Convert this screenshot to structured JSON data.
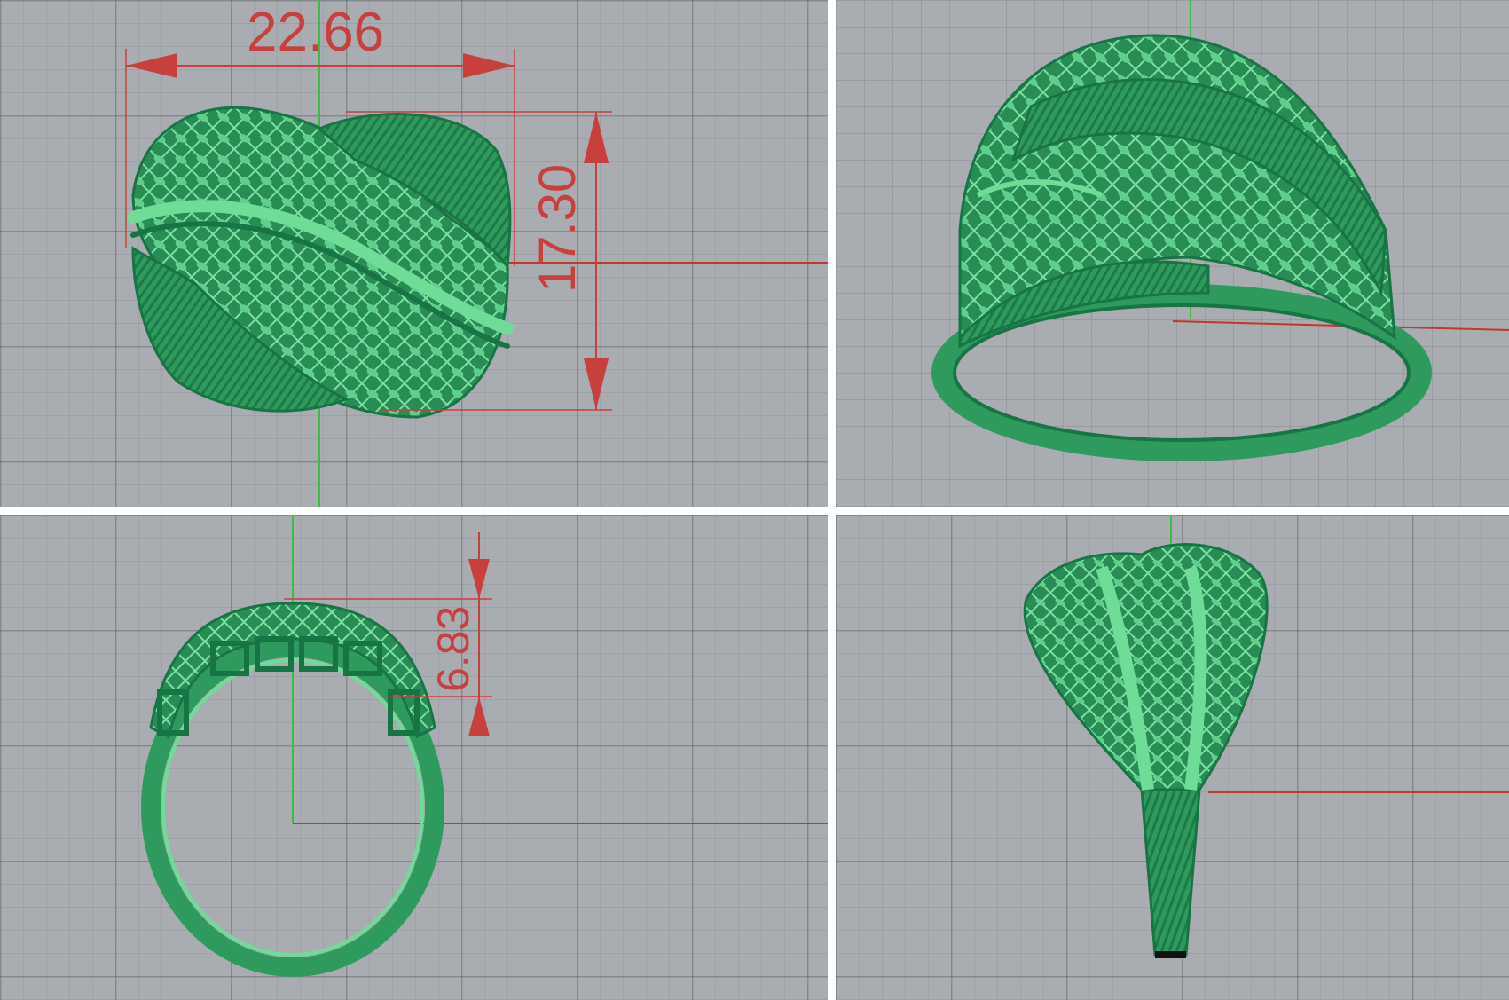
{
  "viewports": {
    "top": {
      "dimensions": {
        "width": "22.66",
        "height": "17.30"
      }
    },
    "perspective": {},
    "front": {
      "dimensions": {
        "thickness": "6.83"
      }
    },
    "right": {}
  },
  "colors": {
    "model": "#2f9a5e",
    "model_dark": "#187444",
    "model_light": "#6fdc98",
    "dimension": "#c8403e",
    "x_axis": "#c0392b",
    "y_axis": "#3dbb44",
    "grid_background": "#a9acb0"
  }
}
